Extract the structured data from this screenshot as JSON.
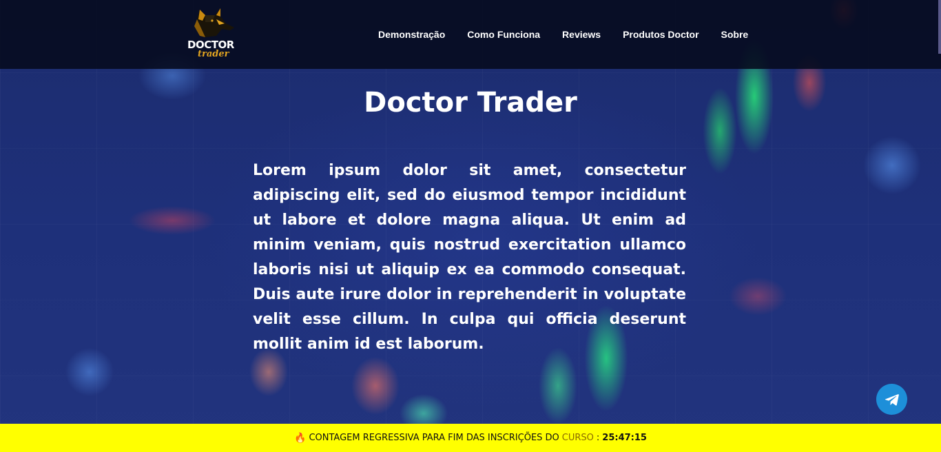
{
  "header": {
    "logo": {
      "line1": "DOCTOR",
      "line2": "trader",
      "icon": "wolf-head-icon"
    },
    "nav": [
      {
        "label": "Demonstração"
      },
      {
        "label": "Como Funciona"
      },
      {
        "label": "Reviews"
      },
      {
        "label": "Produtos Doctor"
      },
      {
        "label": "Sobre"
      }
    ]
  },
  "hero": {
    "title": "Doctor Trader",
    "body": "Lorem ipsum dolor sit amet, consectetur adipiscing elit, sed do eiusmod tempor incididunt ut labore et dolore magna aliqua. Ut enim ad minim veniam, quis nostrud exercitation ullamco laboris nisi ut aliquip ex ea commodo consequat. Duis aute irure dolor in reprehenderit in voluptate velit esse cillum. In culpa qui officia deserunt mollit anim id est laborum."
  },
  "floating": {
    "telegram_icon": "telegram-icon",
    "color": "#1d8fd9"
  },
  "banner": {
    "prefix": "CONTAGEM REGRESSIVA PARA FIM DAS INSCRIÇÕES DO",
    "word": "CURSO",
    "colon": ":",
    "timer": "25:47:15",
    "background": "#ffff00",
    "icon": "fire-icon"
  }
}
